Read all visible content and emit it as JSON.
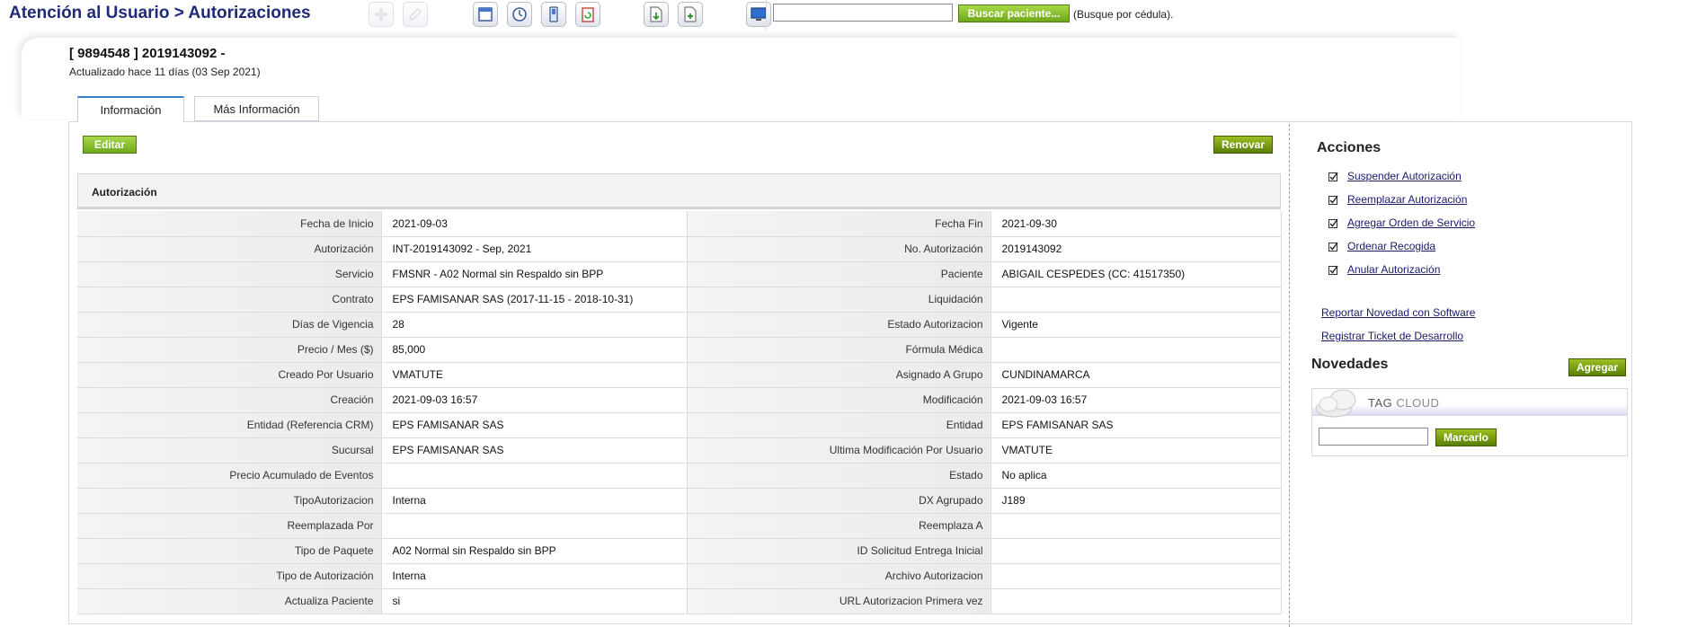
{
  "header": {
    "breadcrumb_part1": "Atención al Usuario",
    "breadcrumb_sep": " > ",
    "breadcrumb_part2": "Autorizaciones",
    "toolbar_icons": [
      "add-icon",
      "edit-icon",
      "calendar-window-icon",
      "clock-icon",
      "device-icon",
      "clipboard-refresh-icon",
      "download-document-icon",
      "add-document-icon",
      "monitor-icon"
    ],
    "search_value": "",
    "search_button": "Buscar paciente...",
    "search_hint": "(Busque por cédula)."
  },
  "record": {
    "title": "[ 9894548 ] 2019143092 -",
    "updated": "Actualizado hace 11 días (03 Sep 2021)"
  },
  "tabs": [
    {
      "label": "Información",
      "active": true
    },
    {
      "label": "Más Información",
      "active": false
    }
  ],
  "buttons": {
    "edit": "Editar",
    "renew": "Renovar"
  },
  "section_title": "Autorización",
  "rows": [
    {
      "l1": "Fecha de Inicio",
      "v1": "2021-09-03",
      "l2": "Fecha Fin",
      "v2": "2021-09-30"
    },
    {
      "l1": "Autorización",
      "v1": "INT-2019143092 - Sep, 2021",
      "l2": "No. Autorización",
      "v2": "2019143092"
    },
    {
      "l1": "Servicio",
      "v1": "FMSNR - A02 Normal sin Respaldo sin BPP",
      "l2": "Paciente",
      "v2": "ABIGAIL CESPEDES (CC: 41517350)"
    },
    {
      "l1": "Contrato",
      "v1": "EPS FAMISANAR SAS (2017-11-15 - 2018-10-31)",
      "l2": "Liquidación",
      "v2": ""
    },
    {
      "l1": "Días de Vigencia",
      "v1": "28",
      "l2": "Estado Autorizacion",
      "v2": "Vigente"
    },
    {
      "l1": "Precio / Mes ($)",
      "v1": "85,000",
      "l2": "Fórmula Médica",
      "v2": ""
    },
    {
      "l1": "Creado Por Usuario",
      "v1": "VMATUTE",
      "l2": "Asignado A Grupo",
      "v2": "CUNDINAMARCA"
    },
    {
      "l1": "Creación",
      "v1": "2021-09-03 16:57",
      "l2": "Modificación",
      "v2": "2021-09-03 16:57"
    },
    {
      "l1": "Entidad (Referencia CRM)",
      "v1": "EPS FAMISANAR SAS",
      "l2": "Entidad",
      "v2": "EPS FAMISANAR SAS"
    },
    {
      "l1": "Sucursal",
      "v1": "EPS FAMISANAR SAS",
      "l2": "Ultima Modificación Por Usuario",
      "v2": "VMATUTE"
    },
    {
      "l1": "Precio Acumulado de Eventos",
      "v1": "",
      "l2": "Estado",
      "v2": "No aplica"
    },
    {
      "l1": "TipoAutorizacion",
      "v1": "Interna",
      "l2": "DX Agrupado",
      "v2": "J189"
    },
    {
      "l1": "Reemplazada Por",
      "v1": "",
      "l2": "Reemplaza A",
      "v2": ""
    },
    {
      "l1": "Tipo de Paquete",
      "v1": "A02 Normal sin Respaldo sin BPP",
      "l2": "ID Solicitud Entrega Inicial",
      "v2": ""
    },
    {
      "l1": "Tipo de Autorización",
      "v1": "Interna",
      "l2": "Archivo Autorizacion",
      "v2": ""
    },
    {
      "l1": "Actualiza Paciente",
      "v1": "si",
      "l2": "URL Autorizacion Primera vez",
      "v2": ""
    }
  ],
  "sidebar": {
    "acciones_title": "Acciones",
    "actions": [
      "Suspender Autorización",
      "Reemplazar Autorización",
      "Agregar Orden de Servicio",
      "Ordenar Recogida",
      "Anular Autorización"
    ],
    "links": [
      "Reportar Novedad con Software",
      "Registrar Ticket de Desarrollo"
    ],
    "novedades_title": "Novedades",
    "agregar": "Agregar",
    "tag_cloud_tag": "TAG",
    "tag_cloud_cloud": "CLOUD",
    "tag_input_value": "",
    "tag_button": "Marcarlo"
  }
}
